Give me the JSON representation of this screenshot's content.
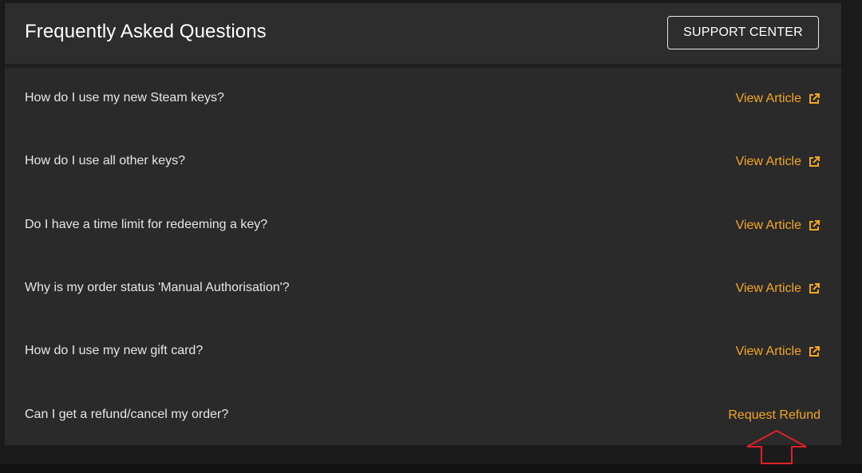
{
  "header": {
    "title": "Frequently Asked Questions",
    "support_label": "SUPPORT CENTER"
  },
  "faq": [
    {
      "question": "How do I use my new Steam keys?",
      "link": "View Article",
      "icon": "external-link-icon"
    },
    {
      "question": "How do I use all other keys?",
      "link": "View Article",
      "icon": "external-link-icon"
    },
    {
      "question": "Do I have a time limit for redeeming a key?",
      "link": "View Article",
      "icon": "external-link-icon"
    },
    {
      "question": "Why is my order status 'Manual Authorisation'?",
      "link": "View Article",
      "icon": "external-link-icon"
    },
    {
      "question": "How do I use my new gift card?",
      "link": "View Article",
      "icon": "external-link-icon"
    },
    {
      "question": "Can I get a refund/cancel my order?",
      "link": "Request Refund",
      "icon": ""
    }
  ],
  "colors": {
    "accent": "#f5a623",
    "panel": "#2a2a2a",
    "annotation": "#e0202a"
  }
}
